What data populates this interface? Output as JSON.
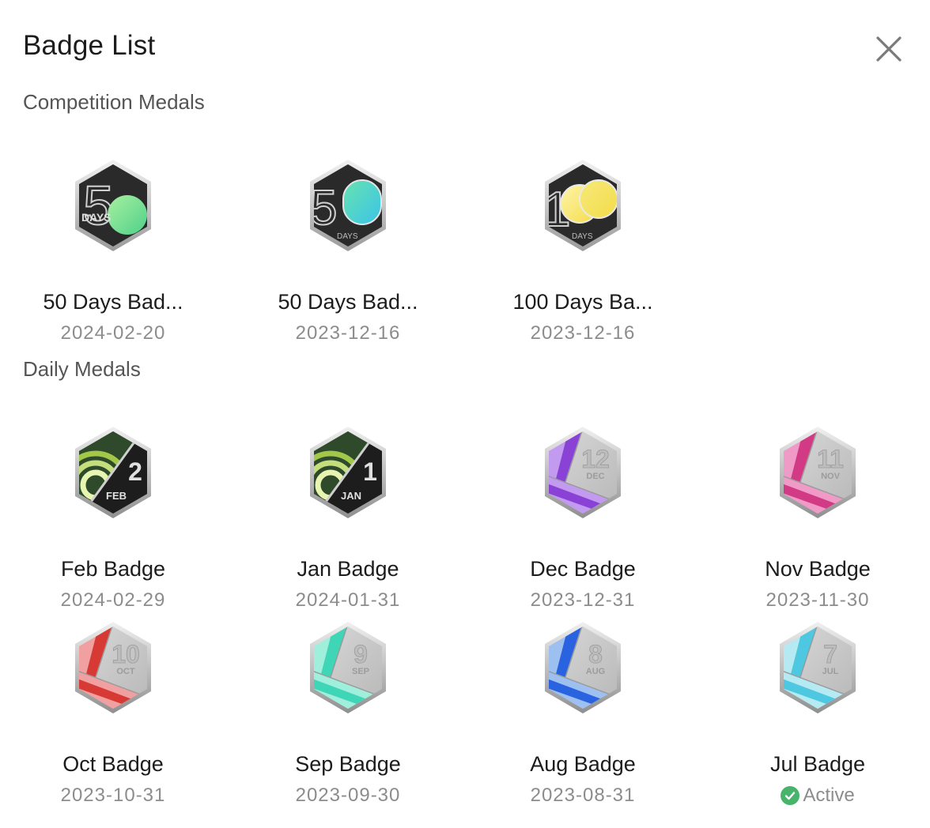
{
  "header": {
    "title": "Badge List"
  },
  "competition": {
    "label": "Competition Medals",
    "items": [
      {
        "name": "50 Days Bad...",
        "date": "2024-02-20",
        "big": "5",
        "small": "DAYS",
        "accent": "#4fd08a",
        "accent2": "#a8f0a0"
      },
      {
        "name": "50 Days Bad...",
        "date": "2023-12-16",
        "big": "50",
        "small": "DAYS",
        "accent": "#3bc3e8",
        "accent2": "#67e3b0"
      },
      {
        "name": "100 Days Ba...",
        "date": "2023-12-16",
        "big": "10",
        "small": "DAYS",
        "accent": "#f3dc4a",
        "accent2": "#f6e97a"
      }
    ]
  },
  "daily": {
    "label": "Daily Medals",
    "items": [
      {
        "name": "Feb Badge",
        "date": "2024-02-29",
        "num": "2",
        "month": "FEB",
        "style": "dark",
        "accent": "#b6dd4f"
      },
      {
        "name": "Jan Badge",
        "date": "2024-01-31",
        "num": "1",
        "month": "JAN",
        "style": "dark",
        "accent": "#b6dd4f"
      },
      {
        "name": "Dec Badge",
        "date": "2023-12-31",
        "num": "12",
        "month": "DEC",
        "style": "silver",
        "accent": "#8a42d6",
        "accent2": "#c29af0"
      },
      {
        "name": "Nov Badge",
        "date": "2023-11-30",
        "num": "11",
        "month": "NOV",
        "style": "silver",
        "accent": "#d23a86",
        "accent2": "#f09ac8"
      },
      {
        "name": "Oct Badge",
        "date": "2023-10-31",
        "num": "10",
        "month": "OCT",
        "style": "silver",
        "accent": "#d73a35",
        "accent2": "#f0a0a0"
      },
      {
        "name": "Sep Badge",
        "date": "2023-09-30",
        "num": "9",
        "month": "SEP",
        "style": "silver",
        "accent": "#3ed6b6",
        "accent2": "#a0efdc"
      },
      {
        "name": "Aug Badge",
        "date": "2023-08-31",
        "num": "8",
        "month": "AUG",
        "style": "silver",
        "accent": "#2a63e0",
        "accent2": "#9ec0f0"
      },
      {
        "name": "Jul Badge",
        "date": "",
        "num": "7",
        "month": "JUL",
        "style": "silver",
        "accent": "#4dc8e0",
        "accent2": "#b5eaf3",
        "status": "Active"
      }
    ]
  }
}
